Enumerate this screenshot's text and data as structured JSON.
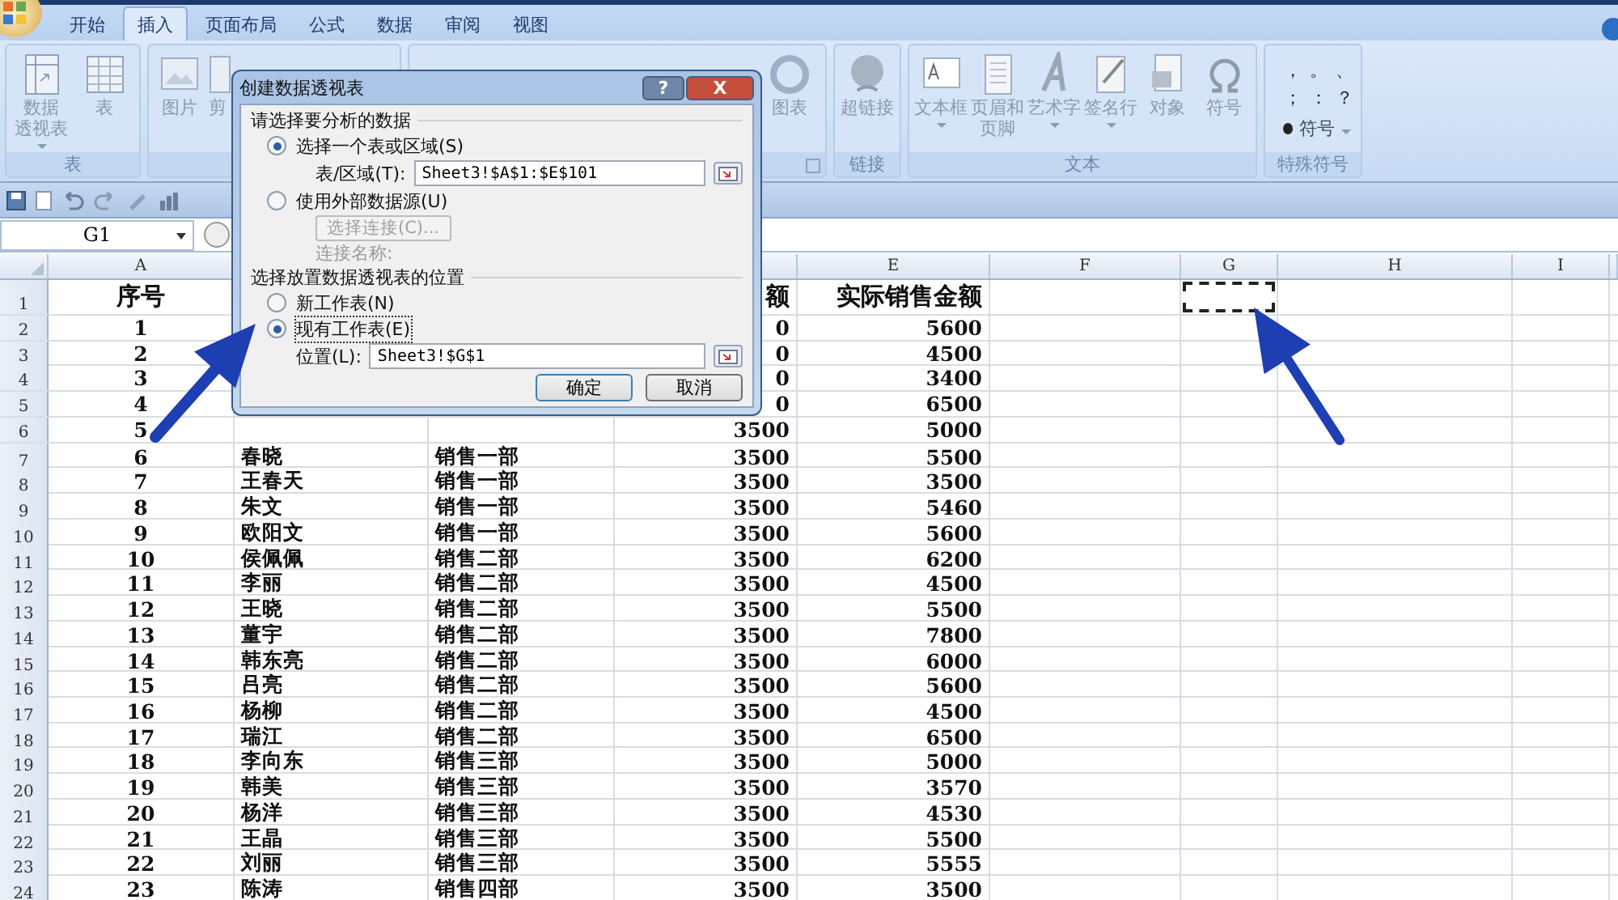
{
  "tabs": [
    {
      "label": "开始",
      "selected": false
    },
    {
      "label": "插入",
      "selected": true
    },
    {
      "label": "页面布局",
      "selected": false
    },
    {
      "label": "公式",
      "selected": false
    },
    {
      "label": "数据",
      "selected": false
    },
    {
      "label": "审阅",
      "selected": false
    },
    {
      "label": "视图",
      "selected": false
    }
  ],
  "ribbon": {
    "groups": [
      {
        "label": "表",
        "buttons": [
          {
            "lines": [
              "数据",
              "透视表"
            ],
            "dropdown": true
          },
          {
            "lines": [
              "表"
            ],
            "dropdown": false
          }
        ]
      },
      {
        "buttons": [
          {
            "lines": [
              "图片"
            ],
            "dropdown": false
          },
          {
            "lines": [
              "剪"
            ],
            "dropdown": false
          }
        ]
      },
      {
        "buttons": [
          {
            "lines": [
              "图表"
            ],
            "dropdown": false
          }
        ]
      },
      {
        "label": "链接",
        "buttons": [
          {
            "lines": [
              "超链接"
            ],
            "dropdown": false
          }
        ]
      },
      {
        "label": "文本",
        "buttons": [
          {
            "lines": [
              "文本框"
            ],
            "dropdown": true
          },
          {
            "lines": [
              "页眉和",
              "页脚"
            ],
            "dropdown": false
          },
          {
            "lines": [
              "艺术字"
            ],
            "dropdown": true
          },
          {
            "lines": [
              "签名行"
            ],
            "dropdown": true
          },
          {
            "lines": [
              "对象"
            ],
            "dropdown": false
          },
          {
            "lines": [
              "符号"
            ],
            "dropdown": false
          }
        ]
      },
      {
        "label": "特殊符号",
        "symbols": [
          "，",
          "。",
          "、",
          "；",
          "：",
          "？"
        ],
        "menu": "符号"
      }
    ]
  },
  "name_box": "G1",
  "sheet": {
    "column_headers": {
      "a": "A",
      "e": "E",
      "f": "F",
      "g": "G",
      "h": "H",
      "i": "I"
    },
    "rows": [
      {
        "header": "1",
        "cells": {
          "a": "序号",
          "d": "额",
          "e": "实际销售金额",
          "g": {
            "marquee": true
          }
        }
      },
      {
        "header": "2",
        "cells": {
          "a": "1",
          "d": "0",
          "e": "5600"
        }
      },
      {
        "header": "3",
        "cells": {
          "a": "2",
          "d": "0",
          "e": "4500"
        }
      },
      {
        "header": "4",
        "cells": {
          "a": "3",
          "d": "0",
          "e": "3400"
        }
      },
      {
        "header": "5",
        "cells": {
          "a": "4",
          "d": "0",
          "e": "6500"
        }
      },
      {
        "header": "6",
        "cells": {
          "a": "5",
          "d": "3500",
          "e": "5000"
        }
      },
      {
        "header": "7",
        "cells": {
          "a": "6",
          "b": "春晓",
          "c": "销售一部",
          "d": "3500",
          "e": "5500"
        }
      },
      {
        "header": "8",
        "cells": {
          "a": "7",
          "b": "王春天",
          "c": "销售一部",
          "d": "3500",
          "e": "3500"
        }
      },
      {
        "header": "9",
        "cells": {
          "a": "8",
          "b": "朱文",
          "c": "销售一部",
          "d": "3500",
          "e": "5460"
        }
      },
      {
        "header": "10",
        "cells": {
          "a": "9",
          "b": "欧阳文",
          "c": "销售一部",
          "d": "3500",
          "e": "5600"
        }
      },
      {
        "header": "11",
        "cells": {
          "a": "10",
          "b": "侯佩佩",
          "c": "销售二部",
          "d": "3500",
          "e": "6200"
        }
      },
      {
        "header": "12",
        "cells": {
          "a": "11",
          "b": "李丽",
          "c": "销售二部",
          "d": "3500",
          "e": "4500"
        }
      },
      {
        "header": "13",
        "cells": {
          "a": "12",
          "b": "王晓",
          "c": "销售二部",
          "d": "3500",
          "e": "5500"
        }
      },
      {
        "header": "14",
        "cells": {
          "a": "13",
          "b": "董宇",
          "c": "销售二部",
          "d": "3500",
          "e": "7800"
        }
      },
      {
        "header": "15",
        "cells": {
          "a": "14",
          "b": "韩东亮",
          "c": "销售二部",
          "d": "3500",
          "e": "6000"
        }
      },
      {
        "header": "16",
        "cells": {
          "a": "15",
          "b": "吕亮",
          "c": "销售二部",
          "d": "3500",
          "e": "5600"
        }
      },
      {
        "header": "17",
        "cells": {
          "a": "16",
          "b": "杨柳",
          "c": "销售二部",
          "d": "3500",
          "e": "4500"
        }
      },
      {
        "header": "18",
        "cells": {
          "a": "17",
          "b": "瑞江",
          "c": "销售二部",
          "d": "3500",
          "e": "6500"
        }
      },
      {
        "header": "19",
        "cells": {
          "a": "18",
          "b": "李向东",
          "c": "销售三部",
          "d": "3500",
          "e": "5000"
        }
      },
      {
        "header": "20",
        "cells": {
          "a": "19",
          "b": "韩美",
          "c": "销售三部",
          "d": "3500",
          "e": "3570"
        }
      },
      {
        "header": "21",
        "cells": {
          "a": "20",
          "b": "杨洋",
          "c": "销售三部",
          "d": "3500",
          "e": "4530"
        }
      },
      {
        "header": "22",
        "cells": {
          "a": "21",
          "b": "王晶",
          "c": "销售三部",
          "d": "3500",
          "e": "5500"
        }
      },
      {
        "header": "23",
        "cells": {
          "a": "22",
          "b": "刘丽",
          "c": "销售三部",
          "d": "3500",
          "e": "5555"
        }
      },
      {
        "header": "24",
        "cells": {
          "a": "23",
          "b": "陈涛",
          "c": "销售四部",
          "d": "3500",
          "e": "3500"
        }
      }
    ]
  },
  "dialog": {
    "title": "创建数据透视表",
    "help": "?",
    "close": "X",
    "sections": [
      {
        "heading": "请选择要分析的数据",
        "items": [
          {
            "kind": "radio",
            "label": "选择一个表或区域(S)",
            "selected": true
          },
          {
            "kind": "field",
            "label": "表/区域(T):",
            "value": "Sheet3!$A$1:$E$101"
          },
          {
            "kind": "radio",
            "label": "使用外部数据源(U)",
            "selected": false
          },
          {
            "kind": "button",
            "label": "选择连接(C)...",
            "disabled": true
          },
          {
            "kind": "label",
            "label": "连接名称:",
            "disabled": true
          }
        ]
      },
      {
        "heading": "选择放置数据透视表的位置",
        "items": [
          {
            "kind": "radio",
            "label": "新工作表(N)",
            "selected": false
          },
          {
            "kind": "radio",
            "label": "现有工作表(E)",
            "selected": true
          },
          {
            "kind": "field",
            "label": "位置(L):",
            "value": "Sheet3!$G$1"
          }
        ]
      }
    ],
    "buttons": [
      "确定",
      "取消"
    ]
  }
}
